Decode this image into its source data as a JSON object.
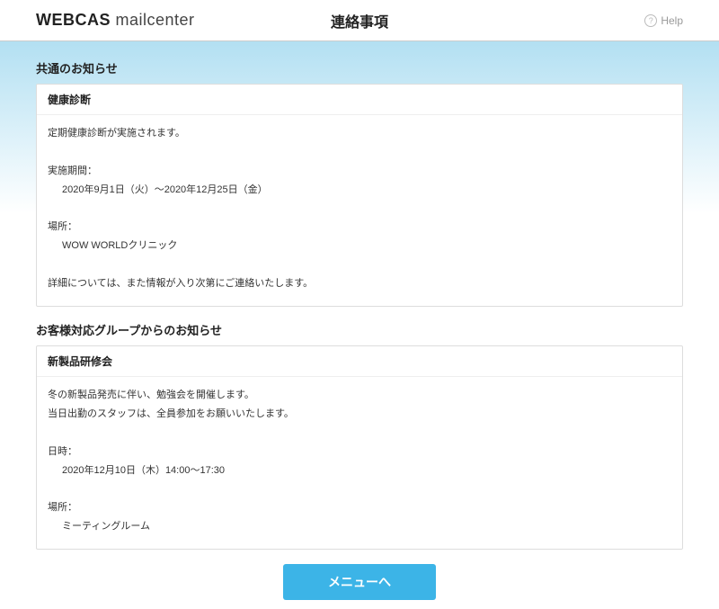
{
  "header": {
    "logo_bold": "WEBCAS",
    "logo_thin": "mailcenter",
    "title": "連絡事項",
    "help": "Help"
  },
  "section1": {
    "heading": "共通のお知らせ",
    "title": "健康診断",
    "line1": "定期健康診断が実施されます。",
    "label_period": "実施期間：",
    "period": "2020年9月1日（火）～2020年12月25日（金）",
    "label_place": "場所：",
    "place": "WOW WORLDクリニック",
    "footnote": "詳細については、また情報が入り次第にご連絡いたします。"
  },
  "section2": {
    "heading": "お客様対応グループからのお知らせ",
    "title": "新製品研修会",
    "line1": "冬の新製品発売に伴い、勉強会を開催します。",
    "line2": "当日出勤のスタッフは、全員参加をお願いいたします。",
    "label_datetime": "日時：",
    "datetime": "2020年12月10日（木）14:00～17:30",
    "label_place": "場所：",
    "place": "ミーティングルーム"
  },
  "button": {
    "menu": "メニューへ"
  }
}
